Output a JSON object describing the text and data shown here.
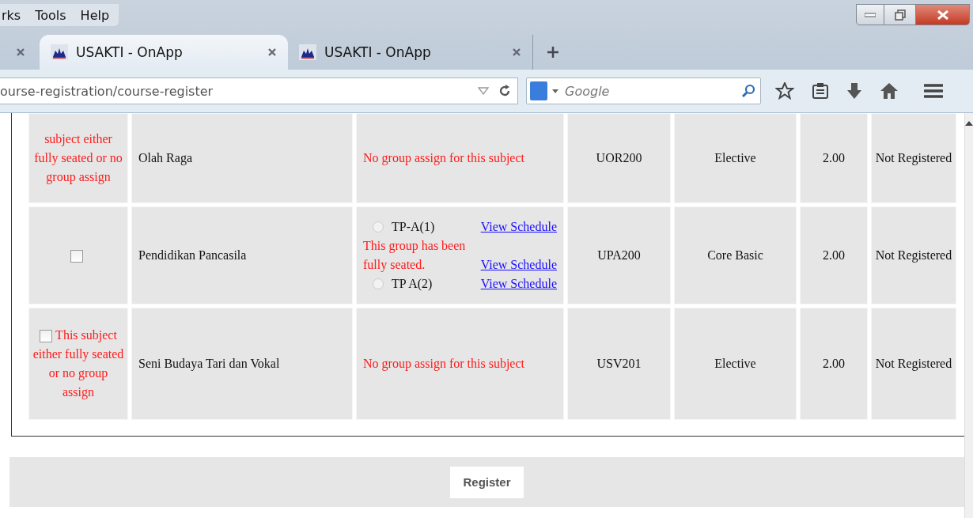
{
  "menu": [
    "rks",
    "Tools",
    "Help"
  ],
  "tabs": [
    {
      "label": "USAKTI - OnApp",
      "selected": true
    },
    {
      "label": "USAKTI - OnApp",
      "selected": false
    }
  ],
  "address_bar": {
    "value": "ourse-registration/course-register"
  },
  "search": {
    "placeholder": "Google"
  },
  "rows": [
    {
      "select": {
        "kind": "warning",
        "text": "subject either fully seated or no group assign"
      },
      "subject": "Olah Raga",
      "group": {
        "kind": "message",
        "text": "No group assign for this subject"
      },
      "code": "UOR200",
      "category": "Elective",
      "credit": "2.00",
      "status": "Not Registered"
    },
    {
      "select": {
        "kind": "checkbox",
        "checked": false
      },
      "subject": "Pendidikan Pancasila",
      "group": {
        "kind": "options",
        "items": [
          {
            "kind": "option",
            "label": "TP-A(1)",
            "selected": false,
            "link": "View Schedule"
          },
          {
            "kind": "full",
            "label": "This group has been fully seated.",
            "link": "View Schedule"
          },
          {
            "kind": "option",
            "label": "TP A(2)",
            "selected": false,
            "link": "View Schedule"
          }
        ]
      },
      "code": "UPA200",
      "category": "Core Basic",
      "credit": "2.00",
      "status": "Not Registered"
    },
    {
      "select": {
        "kind": "checkbox-warning",
        "checked": false,
        "text": "This subject either fully seated or no group assign"
      },
      "subject": "Seni Budaya Tari dan Vokal",
      "group": {
        "kind": "message",
        "text": "No group assign for this subject"
      },
      "code": "USV201",
      "category": "Elective",
      "credit": "2.00",
      "status": "Not Registered"
    }
  ],
  "register_button": "Register"
}
